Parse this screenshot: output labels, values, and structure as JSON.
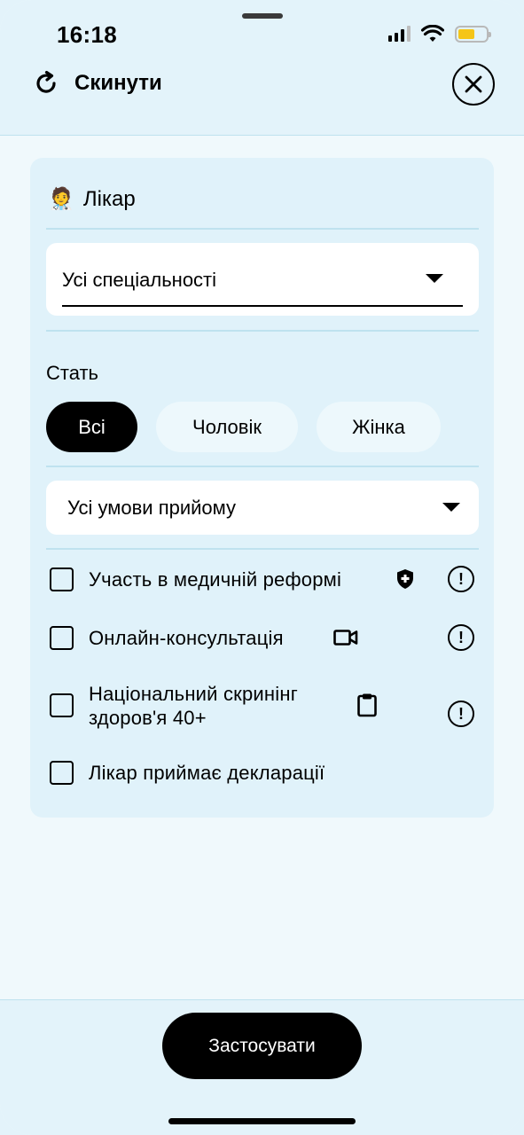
{
  "status_bar": {
    "time": "16:18"
  },
  "header": {
    "reset_label": "Скинути"
  },
  "doctor_section": {
    "title": "Лікар",
    "emoji": "🧑‍⚕️",
    "specialty_select": "Усі спеціальності"
  },
  "gender": {
    "label": "Стать",
    "options": [
      "Всі",
      "Чоловік",
      "Жінка"
    ],
    "selected": "Всі"
  },
  "conditions_select": "Усі умови прийому",
  "checkboxes": [
    {
      "label": "Участь в медичній реформі",
      "icon": "shield-plus-icon",
      "info": true,
      "checked": false
    },
    {
      "label": "Онлайн-консультація",
      "icon": "video-camera-icon",
      "info": true,
      "checked": false
    },
    {
      "label_line1": "Національний скринінг",
      "label_line2": "здоров'я 40+",
      "icon": "clipboard-icon",
      "info": true,
      "checked": false
    },
    {
      "label": "Лікар приймає декларації",
      "info": false,
      "checked": false
    }
  ],
  "footer": {
    "apply_label": "Застосувати"
  },
  "colors": {
    "background": "#f0f9fc",
    "card": "#e0f2fa",
    "accent": "#000000",
    "divider": "#bfe2ef",
    "battery": "#f5c518"
  }
}
